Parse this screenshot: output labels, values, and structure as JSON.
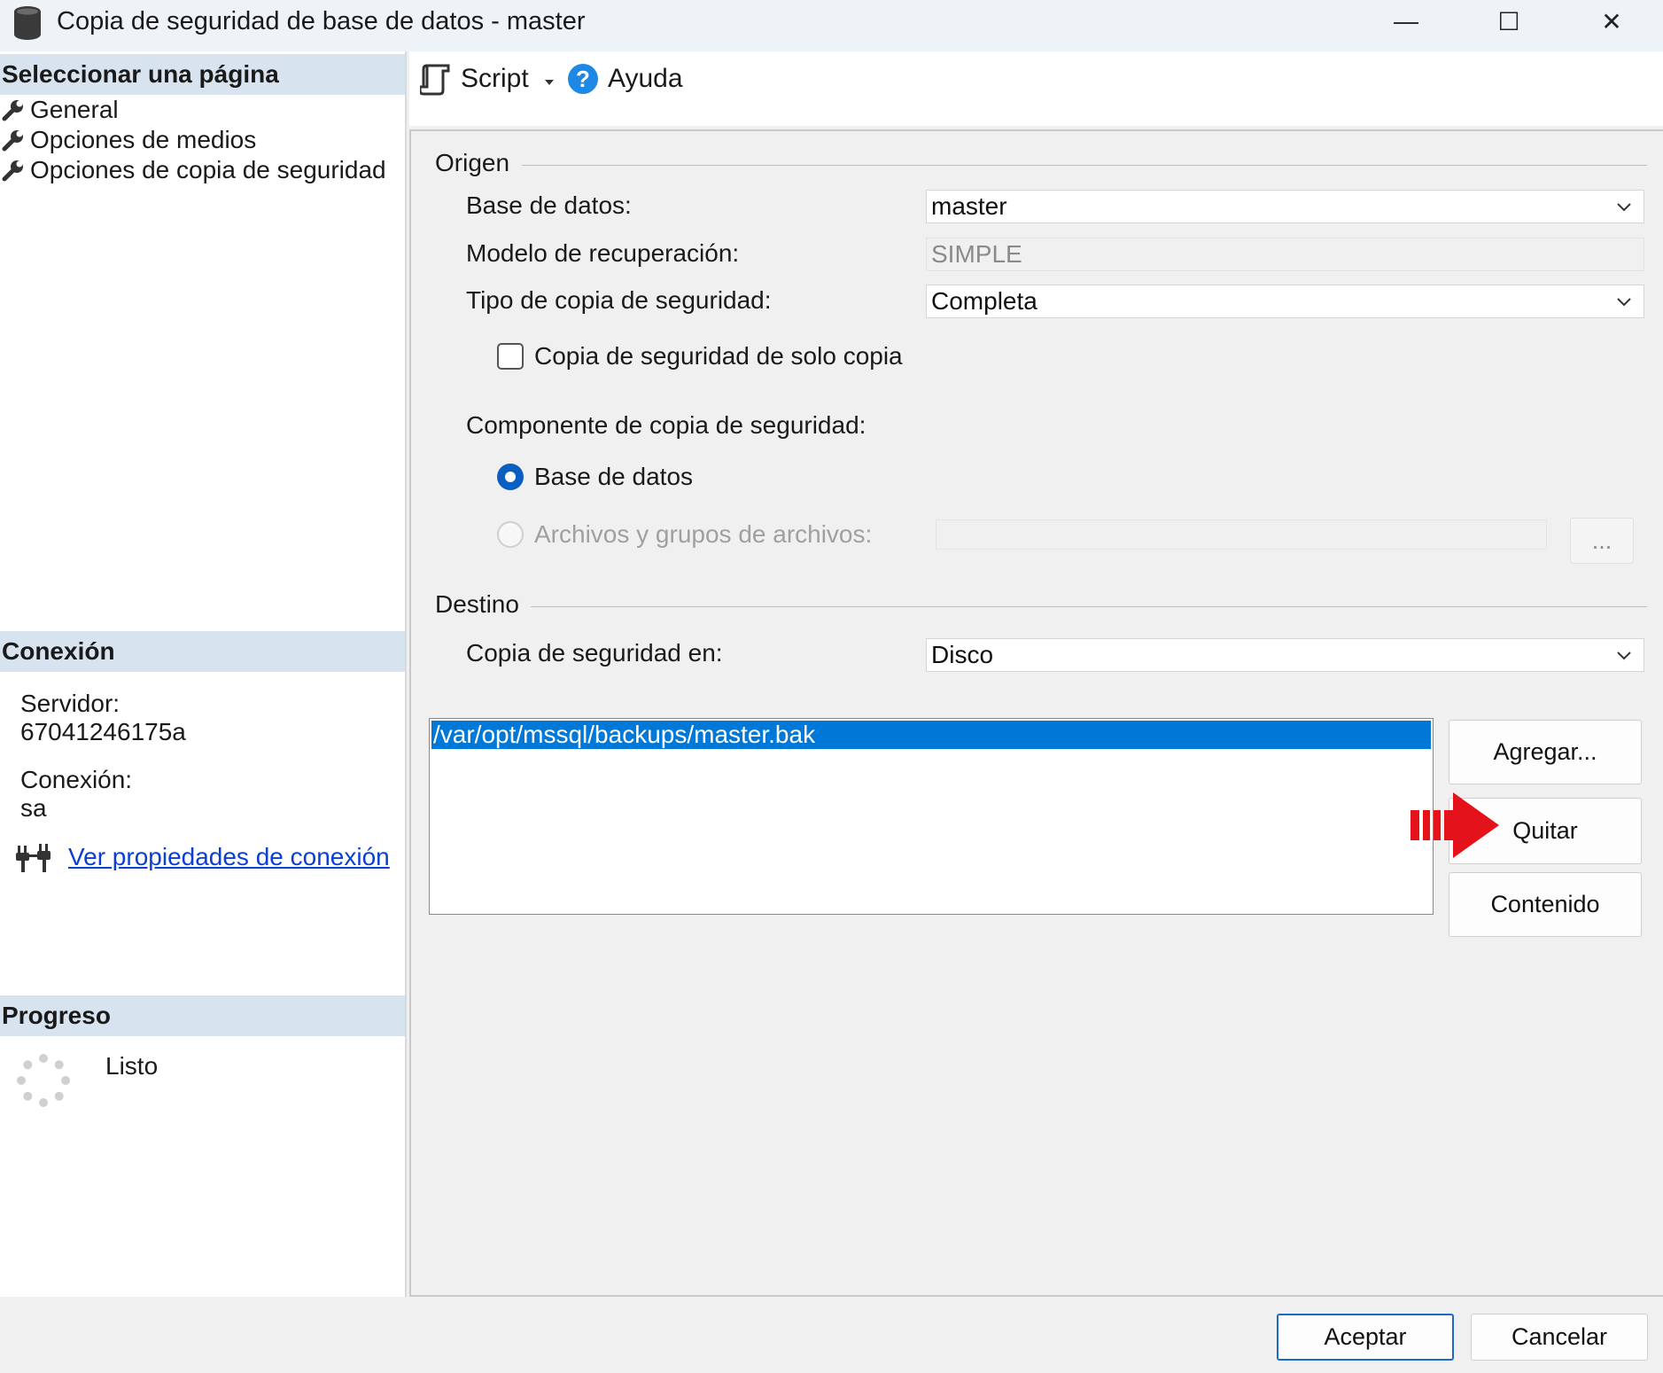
{
  "window": {
    "title": "Copia de seguridad de base de datos - master",
    "minimize_glyph": "—",
    "maximize_glyph": "☐",
    "close_glyph": "✕"
  },
  "left_panel": {
    "select_page": {
      "header": "Seleccionar una página",
      "items": [
        {
          "label": "General",
          "icon": "wrench-icon"
        },
        {
          "label": "Opciones de medios",
          "icon": "wrench-icon"
        },
        {
          "label": "Opciones de copia de seguridad",
          "icon": "wrench-icon"
        }
      ]
    },
    "connection": {
      "header": "Conexión",
      "server_label": "Servidor:",
      "server_value": "67041246175a",
      "connection_label": "Conexión:",
      "connection_value": "sa",
      "properties_link": "Ver propiedades de conexión"
    },
    "progress": {
      "header": "Progreso",
      "status": "Listo"
    }
  },
  "toolbar": {
    "script_label": "Script",
    "help_label": "Ayuda"
  },
  "source": {
    "header": "Origen",
    "database_label": "Base de datos:",
    "database_value": "master",
    "recovery_label": "Modelo de recuperación:",
    "recovery_value": "SIMPLE",
    "backup_type_label": "Tipo de copia de seguridad:",
    "backup_type_value": "Completa",
    "copy_only_label": "Copia de seguridad de solo copia",
    "copy_only_checked": false,
    "component_label": "Componente de copia de seguridad:",
    "component_database_label": "Base de datos",
    "component_files_label": "Archivos y grupos de archivos:",
    "component_selected": "Base de datos",
    "browse_label": "..."
  },
  "destination": {
    "header": "Destino",
    "backup_to_label": "Copia de seguridad en:",
    "backup_to_value": "Disco",
    "paths": [
      "/var/opt/mssql/backups/master.bak"
    ],
    "add_button": "Agregar...",
    "remove_button": "Quitar",
    "contents_button": "Contenido"
  },
  "footer": {
    "ok_button": "Aceptar",
    "cancel_button": "Cancelar"
  },
  "colors": {
    "section_header_bg": "#d7e3ef",
    "selection_blue": "#0078d7",
    "link_blue": "#0b3fd4",
    "arrow_red": "#e3121b",
    "radio_blue": "#0a5fc0"
  }
}
